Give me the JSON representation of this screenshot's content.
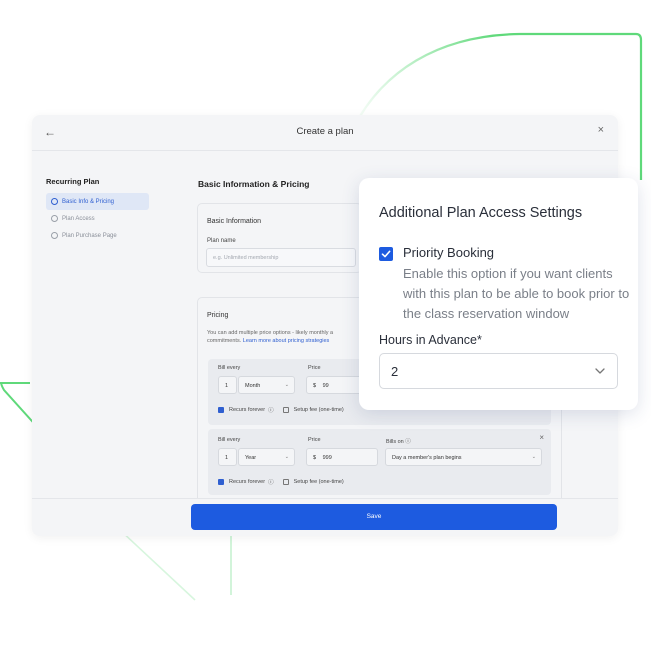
{
  "window": {
    "title": "Create a plan",
    "back_icon": "←",
    "close_icon": "×"
  },
  "sidebar": {
    "title": "Recurring Plan",
    "items": [
      {
        "label": "Basic Info & Pricing",
        "active": true
      },
      {
        "label": "Plan Access",
        "active": false
      },
      {
        "label": "Plan Purchase Page",
        "active": false
      }
    ]
  },
  "main": {
    "section_title": "Basic Information & Pricing",
    "basic_info": {
      "title": "Basic Information",
      "plan_name_label": "Plan name",
      "plan_name_placeholder": "e.g. Unlimited membership"
    },
    "pricing": {
      "title": "Pricing",
      "description_prefix": "You can add multiple price options - likely monthly a",
      "description_line2": "commitments.",
      "link_text": "Learn more about pricing strategies",
      "rows": [
        {
          "bill_every_label": "Bill every",
          "quantity": "1",
          "period": "Month",
          "price_label": "Price",
          "currency": "$",
          "price": "99",
          "recurs_label": "Recurs forever",
          "info_icon": "ⓘ",
          "setup_fee_label": "Setup fee (one-time)"
        },
        {
          "bill_every_label": "Bill every",
          "quantity": "1",
          "period": "Year",
          "price_label": "Price",
          "currency": "$",
          "price": "999",
          "bills_on_label": "Bills on",
          "info_icon": "ⓘ",
          "bills_on_value": "Day a member's plan begins",
          "recurs_label": "Recurs forever",
          "setup_fee_label": "Setup fee (one-time)",
          "close_icon": "×"
        }
      ]
    }
  },
  "footer": {
    "save_label": "Save"
  },
  "popup": {
    "title": "Additional Plan Access Settings",
    "option_label": "Priority Booking",
    "option_checked": true,
    "option_description": "Enable this option if you want clients with this plan to be able to book prior to the class reservation window",
    "hours_label": "Hours in Advance*",
    "hours_value": "2"
  },
  "colors": {
    "accent": "#1d5be0",
    "decor_green": "#5fd97a"
  }
}
